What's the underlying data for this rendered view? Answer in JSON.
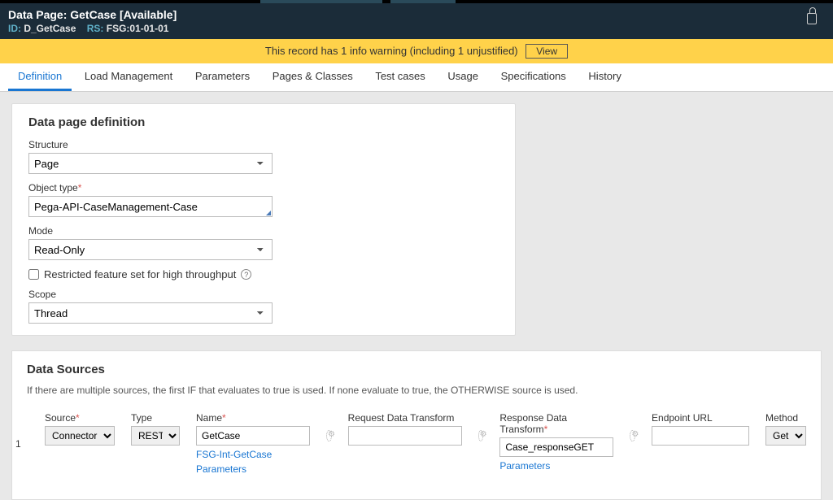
{
  "header": {
    "type_label": "Data Page:",
    "name": "GetCase",
    "status": "[Available]",
    "id_label": "ID:",
    "id_value": "D_GetCase",
    "rs_label": "RS:",
    "rs_value": "FSG:01-01-01"
  },
  "warning": {
    "text": "This record has 1 info warning (including 1 unjustified)",
    "view_label": "View"
  },
  "tabs": [
    "Definition",
    "Load Management",
    "Parameters",
    "Pages & Classes",
    "Test cases",
    "Usage",
    "Specifications",
    "History"
  ],
  "definition": {
    "title": "Data page definition",
    "structure_label": "Structure",
    "structure_value": "Page",
    "object_type_label": "Object type",
    "object_type_value": "Pega-API-CaseManagement-Case",
    "mode_label": "Mode",
    "mode_value": "Read-Only",
    "restricted_label": "Restricted feature set for high throughput",
    "scope_label": "Scope",
    "scope_value": "Thread"
  },
  "sources": {
    "title": "Data Sources",
    "hint": "If there are multiple sources, the first IF that evaluates to true is used. If none evaluate to true, the OTHERWISE source is used.",
    "row_number": "1",
    "cols": {
      "source_label": "Source",
      "source_value": "Connector",
      "type_label": "Type",
      "type_value": "REST",
      "name_label": "Name",
      "name_value": "GetCase",
      "name_sub1": "FSG-Int-GetCase",
      "name_sub2": "Parameters",
      "req_label": "Request Data Transform",
      "resp_label": "Response Data Transform",
      "resp_value": "Case_responseGET",
      "resp_sub": "Parameters",
      "endpoint_label": "Endpoint URL",
      "method_label": "Method",
      "method_value": "Get"
    }
  }
}
